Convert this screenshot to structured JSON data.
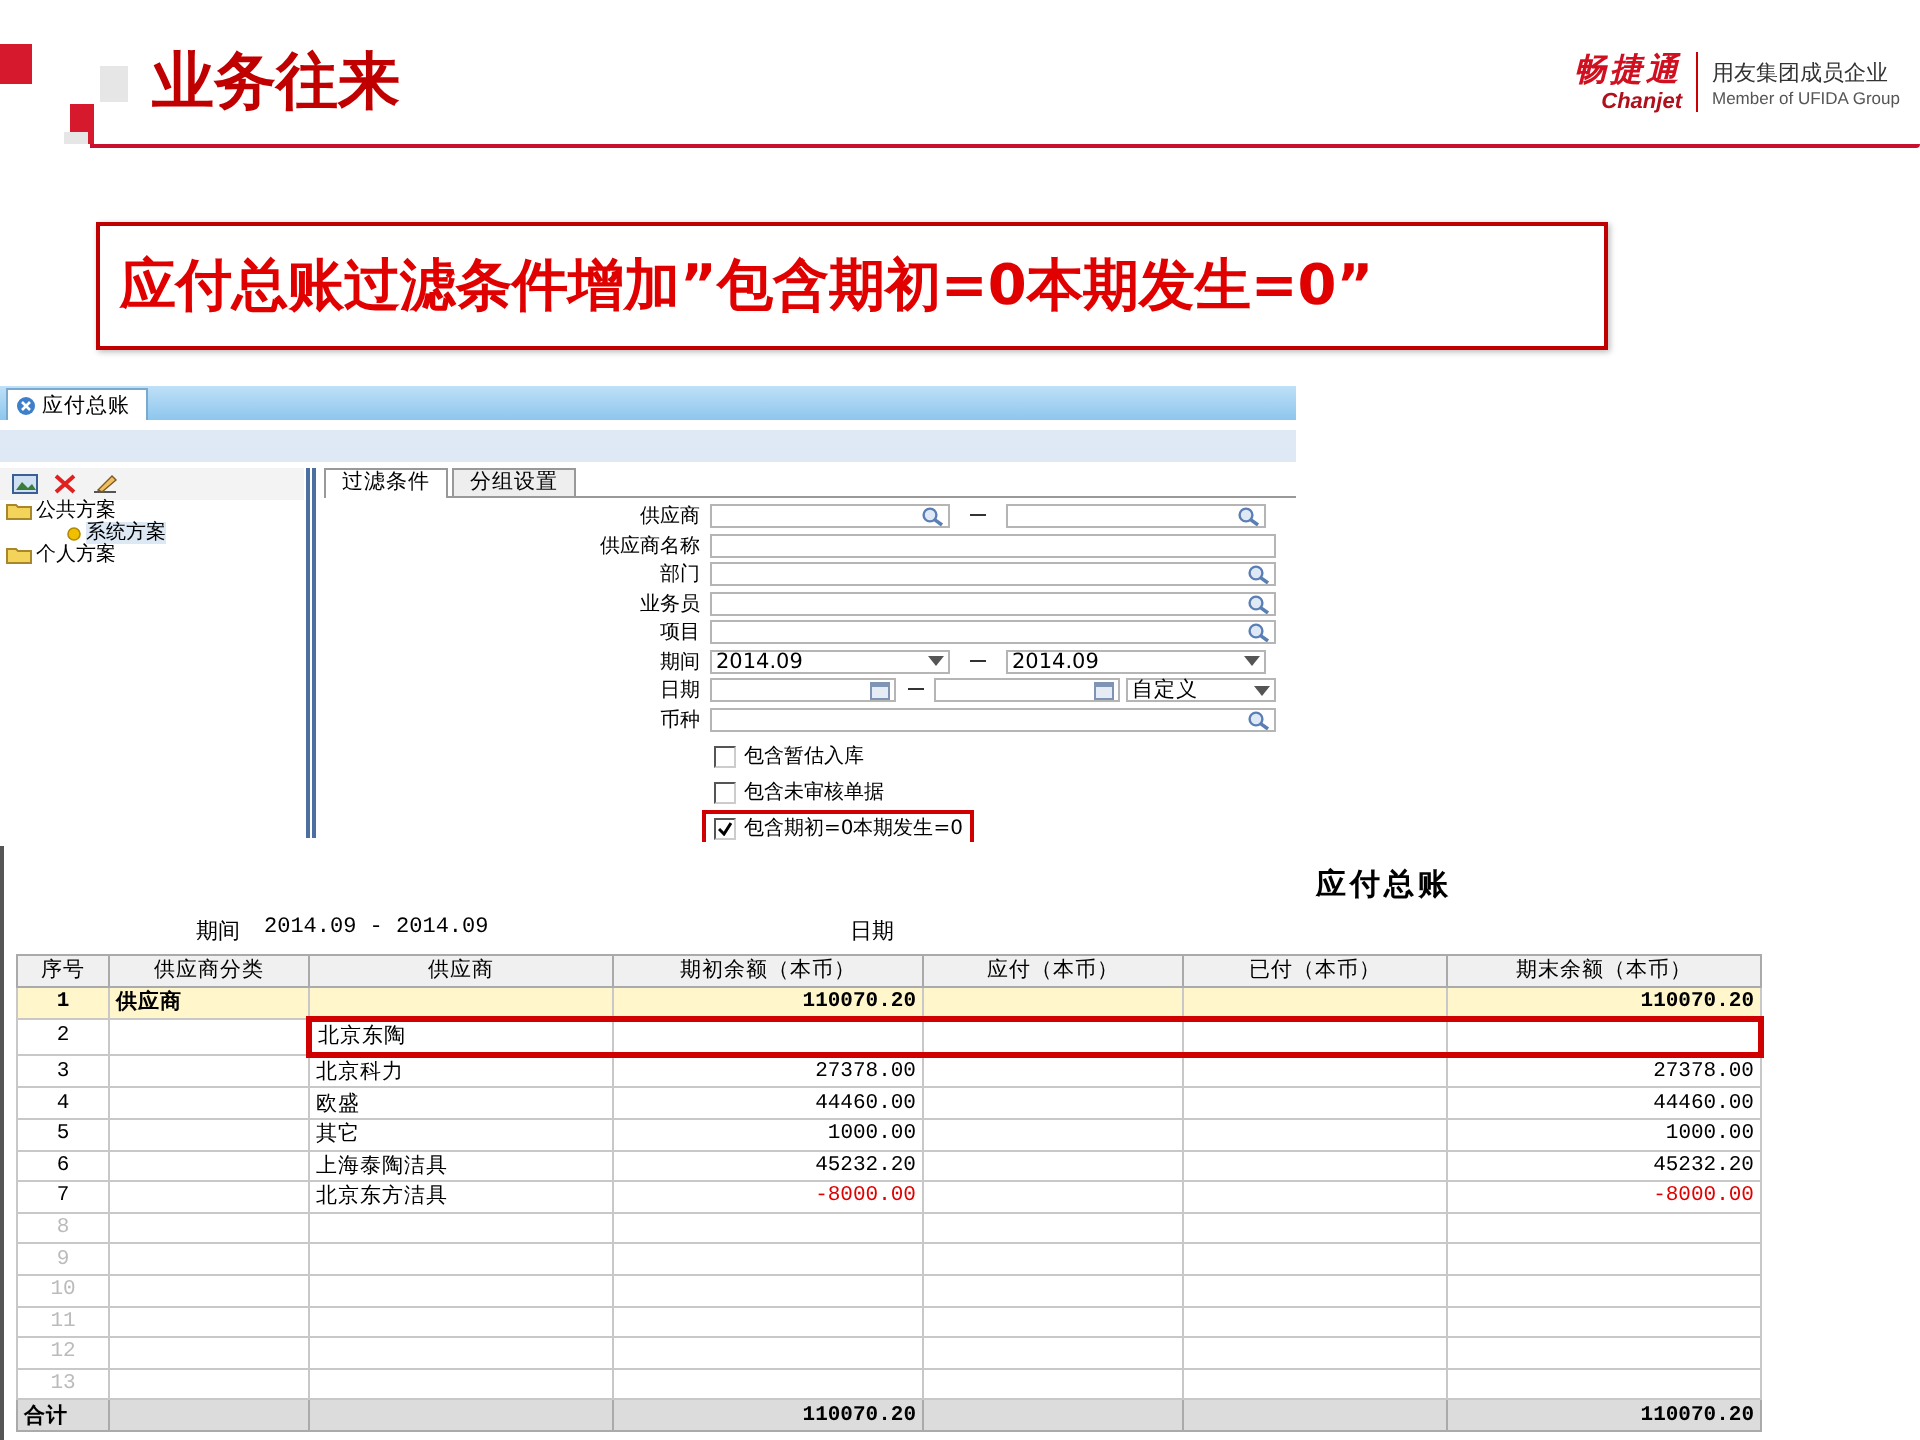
{
  "slide": {
    "title": "业务往来",
    "logo": {
      "brand": "畅捷通",
      "brand_latin": "Chanjet",
      "group": "用友集团成员企业",
      "group_latin": "Member of UFIDA Group"
    },
    "callout": "应付总账过滤条件增加”包含期初=0本期发生=0”"
  },
  "filter_window": {
    "tab": "应付总账",
    "schemes": [
      {
        "label": "公共方案",
        "children": [
          {
            "label": "系统方案"
          }
        ]
      },
      {
        "label": "个人方案"
      }
    ],
    "form_tabs": [
      {
        "label": "过滤条件",
        "selected": true
      },
      {
        "label": "分组设置",
        "selected": false
      }
    ],
    "fields": [
      {
        "kind": "lookup_range",
        "label": "供应商"
      },
      {
        "kind": "text",
        "label": "供应商名称"
      },
      {
        "kind": "lookup",
        "label": "部门"
      },
      {
        "kind": "lookup",
        "label": "业务员"
      },
      {
        "kind": "lookup",
        "label": "项目"
      },
      {
        "kind": "select_range",
        "label": "期间",
        "from": "2014.09",
        "to": "2014.09"
      },
      {
        "kind": "date_range",
        "label": "日期",
        "mode": "自定义"
      },
      {
        "kind": "lookup",
        "label": "币种"
      }
    ],
    "options": [
      {
        "label": "包含暂估入库",
        "checked": false,
        "highlighted": false
      },
      {
        "label": "包含未审核单据",
        "checked": false,
        "highlighted": false
      },
      {
        "label": "包含期初=0本期发生=0",
        "checked": true,
        "highlighted": true
      }
    ]
  },
  "report": {
    "title": "应付总账",
    "period_label": "期间",
    "period": "2014.09 - 2014.09",
    "date_label": "日期",
    "columns": [
      "序号",
      "供应商分类",
      "供应商",
      "期初余额（本币）",
      "应付（本币）",
      "已付（本币）",
      "期末余额（本币）"
    ],
    "rows": [
      {
        "kind": "group",
        "highlighted": false,
        "negative": false,
        "no": "1",
        "category": "供应商",
        "opening": "110070.20",
        "closing": "110070.20"
      },
      {
        "kind": "detail",
        "highlighted": true,
        "no": "2",
        "supplier": "北京东陶"
      },
      {
        "kind": "detail",
        "highlighted": false,
        "negative": false,
        "no": "3",
        "supplier": "北京科力",
        "opening": "27378.00",
        "closing": "27378.00"
      },
      {
        "kind": "detail",
        "highlighted": false,
        "negative": false,
        "no": "4",
        "supplier": "欧盛",
        "opening": "44460.00",
        "closing": "44460.00"
      },
      {
        "kind": "detail",
        "highlighted": false,
        "negative": false,
        "no": "5",
        "supplier": "其它",
        "opening": "1000.00",
        "closing": "1000.00"
      },
      {
        "kind": "detail",
        "highlighted": false,
        "negative": false,
        "no": "6",
        "supplier": "上海泰陶洁具",
        "opening": "45232.20",
        "closing": "45232.20"
      },
      {
        "kind": "detail",
        "highlighted": false,
        "negative": true,
        "no": "7",
        "supplier": "北京东方洁具",
        "opening": "-8000.00",
        "closing": "-8000.00"
      },
      {
        "kind": "empty",
        "highlighted": false,
        "no": "8"
      },
      {
        "kind": "empty",
        "highlighted": false,
        "no": "9"
      },
      {
        "kind": "empty",
        "highlighted": false,
        "no": "10"
      },
      {
        "kind": "empty",
        "highlighted": false,
        "no": "11"
      },
      {
        "kind": "empty",
        "highlighted": false,
        "no": "12"
      },
      {
        "kind": "empty",
        "highlighted": false,
        "no": "13"
      },
      {
        "kind": "total",
        "highlighted": false,
        "negative": false,
        "no": "合计",
        "opening": "110070.20",
        "closing": "110070.20"
      }
    ]
  }
}
